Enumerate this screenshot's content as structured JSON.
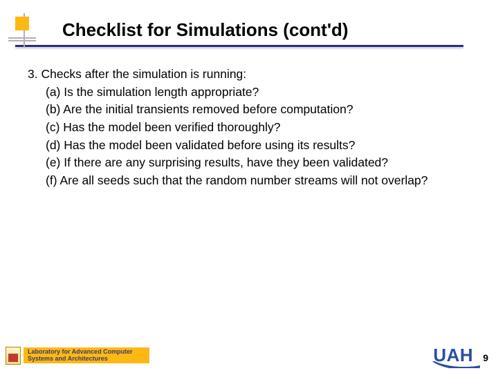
{
  "title": "Checklist for Simulations (cont'd)",
  "section": {
    "number": "3.",
    "heading": "Checks after the simulation is running:",
    "items": [
      {
        "label": "(a)",
        "text": "Is the simulation length appropriate?"
      },
      {
        "label": "(b)",
        "text": "Are the initial transients removed before computation?"
      },
      {
        "label": "(c)",
        "text": "Has the model been verified thoroughly?"
      },
      {
        "label": "(d)",
        "text": "Has the model been validated before using its results?"
      },
      {
        "label": "(e)",
        "text": "If there are any surprising results, have they been validated?"
      },
      {
        "label": "(f)",
        "text": "Are all seeds such that the random number streams will not overlap?"
      }
    ]
  },
  "footer": {
    "lab_line1": "Laboratory for Advanced Computer",
    "lab_line2": "Systems and Architectures",
    "logo": "UAH",
    "page": "9"
  }
}
